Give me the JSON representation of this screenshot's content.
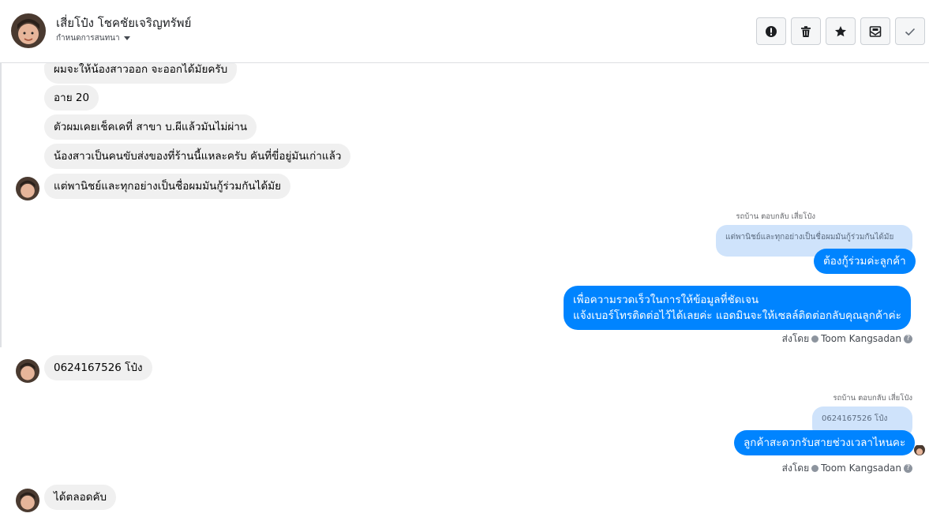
{
  "header": {
    "name": "เสี่ยโป๋ง โชคชัยเจริญทรัพย์",
    "subtitle": "กำหนดการสนทนา",
    "actions": [
      {
        "name": "alert-icon"
      },
      {
        "name": "trash-icon"
      },
      {
        "name": "star-icon"
      },
      {
        "name": "mark-unread-icon"
      },
      {
        "name": "check-icon"
      }
    ]
  },
  "messages": {
    "in_1": "ผมจะให้น้องสาวออก จะออกได้มัยครับ",
    "in_2": "อาย 20",
    "in_3": "ตัวผมเคยเช็คเคที่ สาขา บ.ผีแล้วมันไม่ผ่าน",
    "in_4": "น้องสาวเป็นคนขับส่งของที่ร้านนี้แหละครับ คันที่ขี่อยู่มันเก่าแล้ว",
    "in_5": "แต่พานิชย์และทุกอย่างเป็นชื่อผมมันกู้ร่วมกันได้มัย",
    "reply_meta_1": "รถบ้าน ตอบกลับ เสี่ยโป๋ง",
    "quote_1": "แต่พานิชย์และทุกอย่างเป็นชื่อผมมันกู้ร่วมกันได้มัย",
    "out_1": "ต้องกู้ร่วมค่ะลูกค้า",
    "out_2_line1": "เพื่อความรวดเร็วในการให้ข้อมูลที่ชัดเจน",
    "out_2_line2": "แจ้งเบอร์โทรติดต่อไว้ได้เลยค่ะ แอดมินจะให้เซลล์ติดต่อกลับคุณลูกค้าค่ะ",
    "sent_by_label": "ส่งโดย",
    "sent_by_name": "Toom Kangsadan",
    "in_6": "0624167526 โป๋ง",
    "reply_meta_2": "รถบ้าน ตอบกลับ เสี่ยโป๋ง",
    "quote_2": "0624167526 โป๋ง",
    "out_3": "ลูกค้าสะดวกรับสายช่วงเวลาไหนคะ",
    "in_7": "ได้ตลอดคับ"
  },
  "colors": {
    "outgoing": "#0084ff",
    "incoming": "#f0f0f0",
    "quote": "#cfe3fb"
  }
}
